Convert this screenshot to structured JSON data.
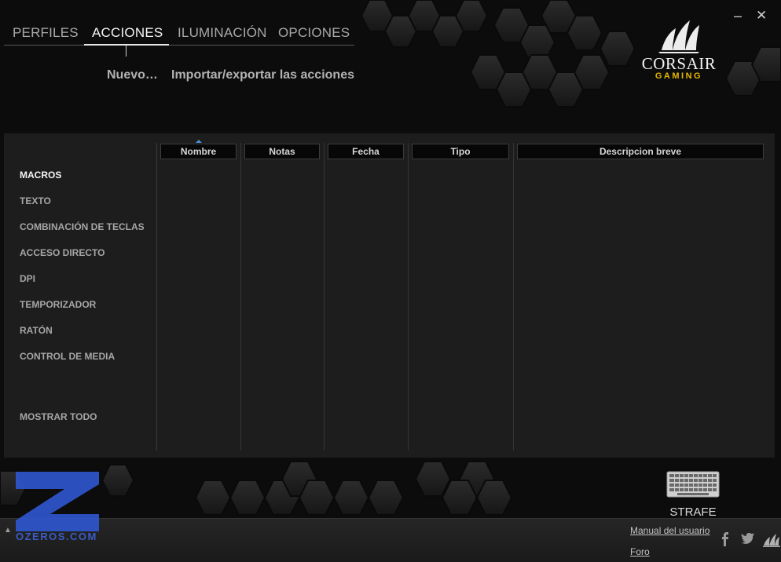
{
  "window": {
    "minimize_glyph": "–",
    "close_glyph": "✕"
  },
  "tabs": [
    {
      "label": "PERFILES",
      "active": false
    },
    {
      "label": "ACCIONES",
      "active": true
    },
    {
      "label": "ILUMINACIÓN",
      "active": false
    },
    {
      "label": "OPCIONES",
      "active": false
    }
  ],
  "subactions": {
    "new": "Nuevo…",
    "import_export": "Importar/exportar las acciones"
  },
  "logo": {
    "wordmark": "CORSAIR",
    "subtitle": "GAMING"
  },
  "side_nav": [
    {
      "label": "MACROS",
      "active": true
    },
    {
      "label": "TEXTO",
      "active": false
    },
    {
      "label": "COMBINACIÓN DE TECLAS",
      "active": false
    },
    {
      "label": "ACCESO DIRECTO",
      "active": false
    },
    {
      "label": "DPI",
      "active": false
    },
    {
      "label": "TEMPORIZADOR",
      "active": false
    },
    {
      "label": "RATÓN",
      "active": false
    },
    {
      "label": "CONTROL DE MEDIA",
      "active": false
    },
    {
      "label": "MOSTRAR TODO",
      "active": false
    }
  ],
  "table": {
    "columns": [
      "Nombre",
      "Notas",
      "Fecha",
      "Tipo",
      "Descripcion breve"
    ],
    "sorted_column": "Nombre",
    "rows": []
  },
  "watermark": {
    "text": "OZEROS.COM"
  },
  "device": {
    "name": "STRAFE",
    "icon": "keyboard-icon"
  },
  "footer": {
    "manual": "Manual del usuario",
    "forum": "Foro",
    "collapse_glyph": "▲",
    "social_icons": [
      "facebook-icon",
      "twitter-icon",
      "corsair-sails-icon"
    ]
  },
  "colors": {
    "accent_gold": "#e8b600",
    "panel": "#1d1d1d",
    "background": "#0c0c0c",
    "sort_indicator": "#4a8fd6",
    "watermark_blue": "#3a5cc8"
  }
}
